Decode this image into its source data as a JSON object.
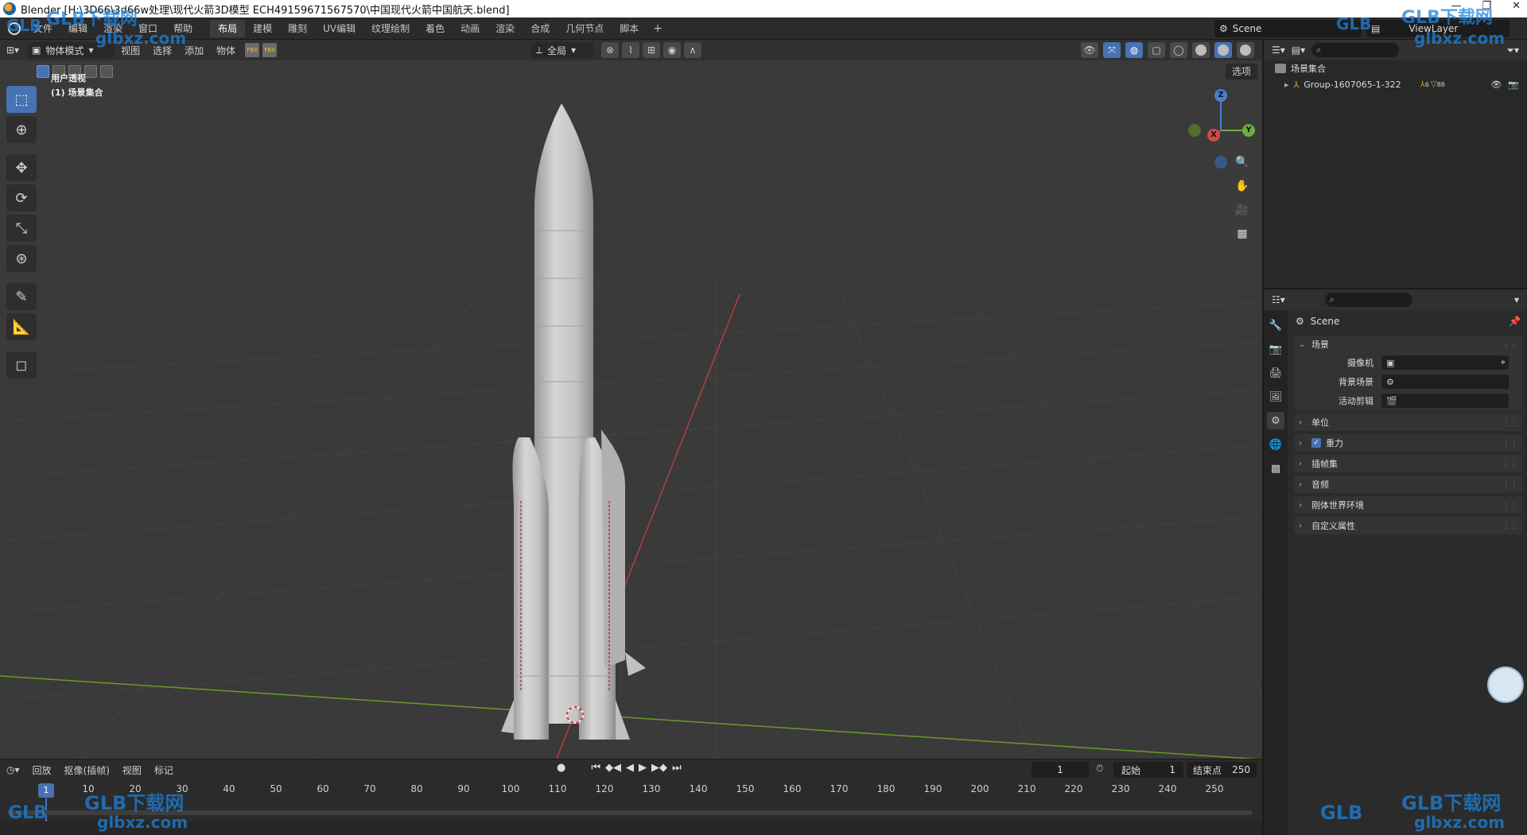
{
  "window": {
    "title": "Blender [H:\\3D66\\3d66w处理\\现代火箭3D模型 ECH49159671567570\\中国现代火箭中国航天.blend]"
  },
  "menu": {
    "items": [
      "文件",
      "编辑",
      "渲染",
      "窗口",
      "帮助"
    ],
    "workspaces": [
      "布局",
      "建模",
      "雕刻",
      "UV编辑",
      "纹理绘制",
      "着色",
      "动画",
      "渲染",
      "合成",
      "几何节点",
      "脚本"
    ],
    "active_workspace": "布局",
    "add_label": "+",
    "scene": "Scene",
    "view_layer": "ViewLayer"
  },
  "viewport": {
    "mode": "物体模式",
    "menus": [
      "视图",
      "选择",
      "添加",
      "物体"
    ],
    "orientation": "全局",
    "options": "选项",
    "view_name": "用户透视",
    "collection_label": "(1) 场景集合",
    "gizmo_axes": {
      "z": "Z",
      "y": "Y",
      "x": "X"
    }
  },
  "outliner": {
    "root": "场景集合",
    "item": "Group-1607065-1-322",
    "badge1": "6",
    "badge2": "88"
  },
  "properties": {
    "title": "Scene",
    "panel_scene": "场景",
    "rows": [
      {
        "label": "摄像机",
        "value": ""
      },
      {
        "label": "背景场景",
        "value": ""
      },
      {
        "label": "活动剪辑",
        "value": ""
      }
    ],
    "collapsed_panels": [
      "单位",
      "重力",
      "插帧集",
      "音频",
      "刚体世界环境",
      "自定义属性"
    ],
    "gravity_checked": true
  },
  "timeline": {
    "menus": [
      "回放",
      "抠像(插帧)",
      "视图",
      "标记"
    ],
    "current_frame": "1",
    "start_label": "起始",
    "start_value": "1",
    "end_label": "结束点",
    "end_value": "250",
    "ticks": [
      "10",
      "20",
      "30",
      "40",
      "50",
      "60",
      "70",
      "80",
      "90",
      "100",
      "110",
      "120",
      "130",
      "140",
      "150",
      "160",
      "170",
      "180",
      "190",
      "200",
      "210",
      "220",
      "230",
      "240",
      "250"
    ]
  },
  "watermark": {
    "brand": "GLB下载网",
    "url": "glbxz.com",
    "logo": "GLB"
  }
}
